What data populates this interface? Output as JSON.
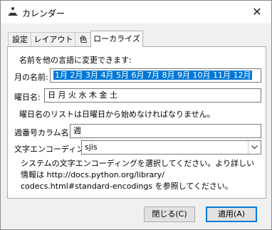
{
  "window": {
    "title": "カレンダー",
    "close_glyph": "✕"
  },
  "tabs": [
    {
      "label": "設定"
    },
    {
      "label": "レイアウト"
    },
    {
      "label": "色"
    },
    {
      "label": "ローカライズ",
      "active": true
    }
  ],
  "panel": {
    "intro": "名前を他の言語に変更できます:",
    "month_names": {
      "label": "月の名前:",
      "value": "1月 2月 3月 4月 5月 6月 7月 8月 9月 10月 11月 12月"
    },
    "weekday_names": {
      "label": "曜日名:",
      "value": "日 月 火 水 木 金 土"
    },
    "weekday_note": "曜日名のリストは日曜日から始めなければなりません。",
    "week_column": {
      "label": "週番号カラム名:",
      "value": "週"
    },
    "encoding": {
      "label": "文字エンコーディング:",
      "value": "sjis",
      "help_line1": "システムの文字エンコーディングを選択してください。より詳しい",
      "help_line2": "情報は http://docs.python.org/library/",
      "help_line3": "codecs.html#standard-encodings を参照してください。"
    }
  },
  "buttons": {
    "close": "閉じる(C)",
    "apply": "適用(A)"
  },
  "colors": {
    "selection": "#0078d7",
    "default_button_border": "#0078d7"
  },
  "icons": {
    "app": "calendar-app-icon",
    "close": "close-icon",
    "dropdown": "chevron-down-icon"
  }
}
